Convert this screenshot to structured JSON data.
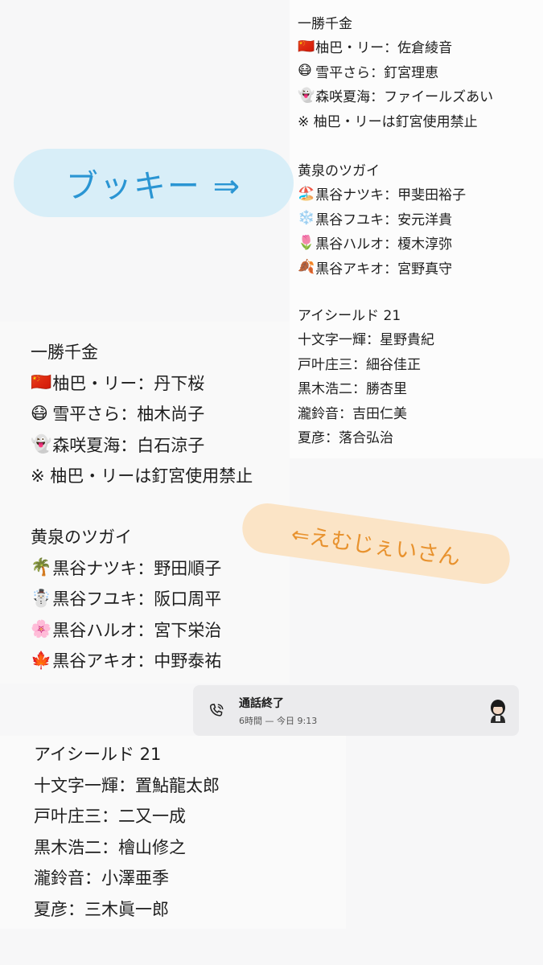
{
  "bubbles": {
    "bukki": "ブッキー ⇒",
    "emujei": "⇐えむじぇいさん"
  },
  "call": {
    "title": "通話終了",
    "subtitle": "6時間 — 今日 9:13",
    "icon": "phone-icon",
    "avatar": "avatar-icon"
  },
  "right_list": {
    "section1": {
      "title": "一勝千金",
      "items": [
        {
          "emoji": "🇨🇳",
          "text": "柚巴・リー：佐倉綾音"
        },
        {
          "emoji": "😷",
          "text": "雪平さら：釘宮理恵"
        },
        {
          "emoji": "👻",
          "text": "森咲夏海：ファイールズあい"
        }
      ],
      "note": "※ 柚巴・リーは釘宮使用禁止"
    },
    "section2": {
      "title": "黄泉のツガイ",
      "items": [
        {
          "emoji": "🏖️",
          "text": "黒谷ナツキ：甲斐田裕子"
        },
        {
          "emoji": "❄️",
          "text": "黒谷フユキ：安元洋貴"
        },
        {
          "emoji": "🌷",
          "text": "黒谷ハルオ：榎木淳弥"
        },
        {
          "emoji": "🍂",
          "text": "黒谷アキオ：宮野真守"
        }
      ]
    },
    "section3": {
      "title": "アイシールド 21",
      "items": [
        {
          "text": "十文字一輝：星野貴紀"
        },
        {
          "text": "戸叶庄三：細谷佳正"
        },
        {
          "text": "黒木浩二：勝杏里"
        },
        {
          "text": "瀧鈴音：吉田仁美"
        },
        {
          "text": "夏彦：落合弘治"
        }
      ]
    }
  },
  "left_list": {
    "section1": {
      "title": "一勝千金",
      "items": [
        {
          "emoji": "🇨🇳",
          "text": "柚巴・リー：丹下桜"
        },
        {
          "emoji": "😷",
          "text": "雪平さら：柚木尚子"
        },
        {
          "emoji": "👻",
          "text": "森咲夏海：白石涼子"
        }
      ],
      "note": "※ 柚巴・リーは釘宮使用禁止"
    },
    "section2": {
      "title": "黄泉のツガイ",
      "items": [
        {
          "emoji": "🌴",
          "text": "黒谷ナツキ：野田順子"
        },
        {
          "emoji": "☃️",
          "text": "黒谷フユキ：阪口周平"
        },
        {
          "emoji": "🌸",
          "text": "黒谷ハルオ：宮下栄治"
        },
        {
          "emoji": "🍁",
          "text": "黒谷アキオ：中野泰祐"
        }
      ]
    },
    "section3": {
      "title": "アイシールド 21",
      "items": [
        {
          "text": "十文字一輝：置鮎龍太郎"
        },
        {
          "text": "戸叶庄三：二又一成"
        },
        {
          "text": "黒木浩二：檜山修之"
        },
        {
          "text": "瀧鈴音：小澤亜季"
        },
        {
          "text": "夏彦：三木眞一郎"
        }
      ]
    }
  }
}
